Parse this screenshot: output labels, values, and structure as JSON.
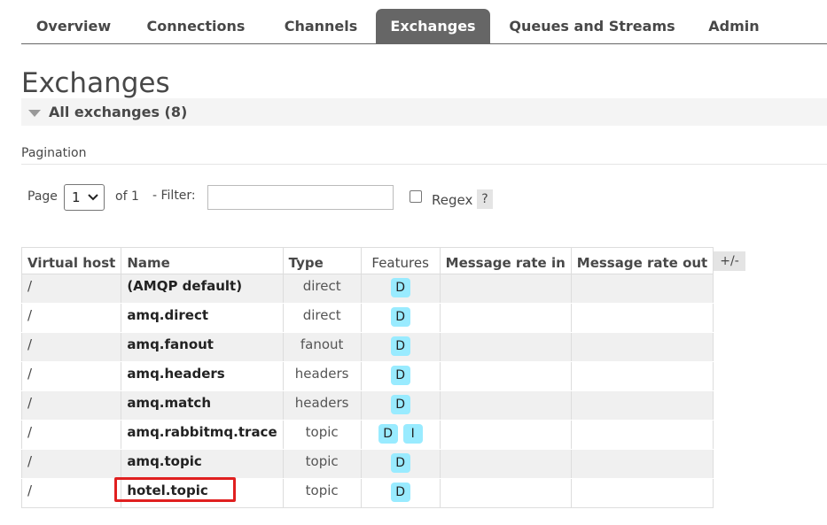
{
  "nav": {
    "tabs": [
      {
        "label": "Overview"
      },
      {
        "label": "Connections"
      },
      {
        "label": "Channels"
      },
      {
        "label": "Exchanges"
      },
      {
        "label": "Queues and Streams"
      },
      {
        "label": "Admin"
      }
    ],
    "active": "Exchanges"
  },
  "page": {
    "title": "Exchanges",
    "section_label": "All exchanges (8)"
  },
  "pagination": {
    "heading": "Pagination",
    "page_label": "Page",
    "current_page": "1",
    "of_label": "of 1",
    "filter_label": "- Filter:",
    "filter_value": "",
    "regex_label": "Regex",
    "help_label": "?"
  },
  "table": {
    "headers": {
      "vhost": "Virtual host",
      "name": "Name",
      "type": "Type",
      "features": "Features",
      "rate_in": "Message rate in",
      "rate_out": "Message rate out"
    },
    "toggle_label": "+/-",
    "rows": [
      {
        "vhost": "/",
        "name": "(AMQP default)",
        "type": "direct",
        "features": [
          "D"
        ],
        "rate_in": "",
        "rate_out": ""
      },
      {
        "vhost": "/",
        "name": "amq.direct",
        "type": "direct",
        "features": [
          "D"
        ],
        "rate_in": "",
        "rate_out": ""
      },
      {
        "vhost": "/",
        "name": "amq.fanout",
        "type": "fanout",
        "features": [
          "D"
        ],
        "rate_in": "",
        "rate_out": ""
      },
      {
        "vhost": "/",
        "name": "amq.headers",
        "type": "headers",
        "features": [
          "D"
        ],
        "rate_in": "",
        "rate_out": ""
      },
      {
        "vhost": "/",
        "name": "amq.match",
        "type": "headers",
        "features": [
          "D"
        ],
        "rate_in": "",
        "rate_out": ""
      },
      {
        "vhost": "/",
        "name": "amq.rabbitmq.trace",
        "type": "topic",
        "features": [
          "D",
          "I"
        ],
        "rate_in": "",
        "rate_out": ""
      },
      {
        "vhost": "/",
        "name": "amq.topic",
        "type": "topic",
        "features": [
          "D"
        ],
        "rate_in": "",
        "rate_out": ""
      },
      {
        "vhost": "/",
        "name": "hotel.topic",
        "type": "topic",
        "features": [
          "D"
        ],
        "rate_in": "",
        "rate_out": ""
      }
    ]
  },
  "colors": {
    "active_tab": "#666666",
    "feature_badge": "#99ebff",
    "highlight_box": "#e02020"
  }
}
